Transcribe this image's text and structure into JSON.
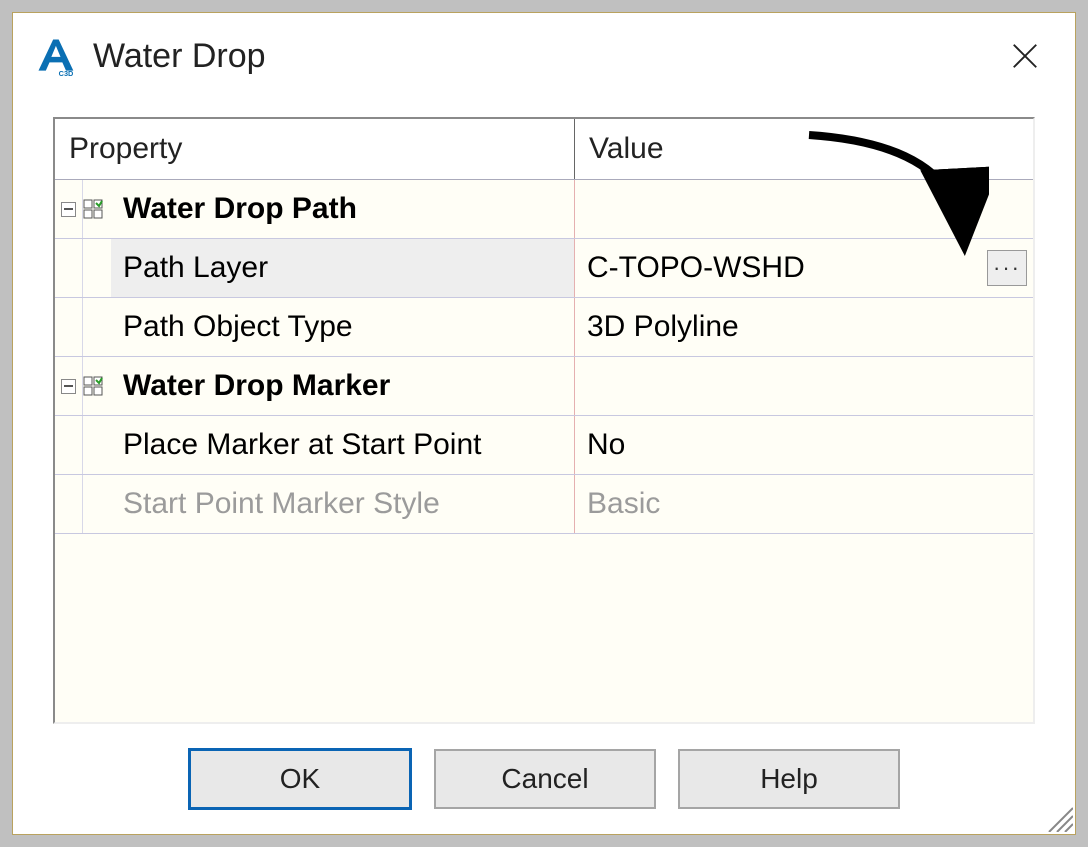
{
  "dialog": {
    "title": "Water Drop"
  },
  "grid": {
    "headers": {
      "property": "Property",
      "value": "Value"
    },
    "groups": [
      {
        "name": "Water Drop Path",
        "rows": [
          {
            "label": "Path Layer",
            "value": "C-TOPO-WSHD",
            "has_browse": true,
            "selected": true
          },
          {
            "label": "Path Object Type",
            "value": "3D Polyline"
          }
        ]
      },
      {
        "name": "Water Drop Marker",
        "rows": [
          {
            "label": "Place Marker at Start Point",
            "value": "No"
          },
          {
            "label": "Start Point Marker Style",
            "value": "Basic",
            "disabled": true
          }
        ]
      }
    ]
  },
  "buttons": {
    "ok": "OK",
    "cancel": "Cancel",
    "help": "Help"
  }
}
